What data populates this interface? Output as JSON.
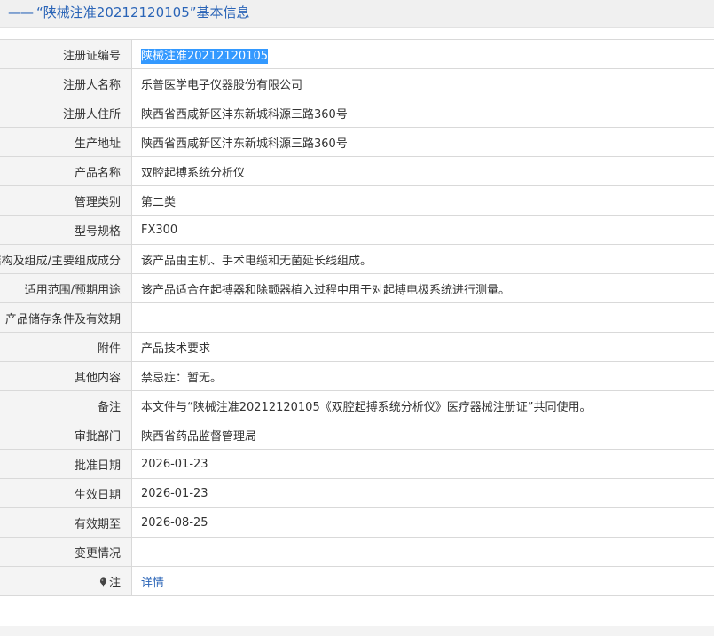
{
  "header": {
    "dash": "——",
    "title": "“陕械注准20212120105”基本信息"
  },
  "rows": [
    {
      "label": "注册证编号",
      "value": "陕械注准20212120105",
      "selected": true
    },
    {
      "label": "注册人名称",
      "value": "乐普医学电子仪器股份有限公司"
    },
    {
      "label": "注册人住所",
      "value": "陕西省西咸新区沣东新城科源三路360号"
    },
    {
      "label": "生产地址",
      "value": "陕西省西咸新区沣东新城科源三路360号"
    },
    {
      "label": "产品名称",
      "value": "双腔起搏系统分析仪"
    },
    {
      "label": "管理类别",
      "value": "第二类"
    },
    {
      "label": "型号规格",
      "value": "FX300"
    },
    {
      "label": "结构及组成/主要组成成分",
      "value": "该产品由主机、手术电缆和无菌延长线组成。"
    },
    {
      "label": "适用范围/预期用途",
      "value": "该产品适合在起搏器和除颤器植入过程中用于对起搏电极系统进行测量。"
    },
    {
      "label": "产品储存条件及有效期",
      "value": ""
    },
    {
      "label": "附件",
      "value": "产品技术要求"
    },
    {
      "label": "其他内容",
      "value": "禁忌症：暂无。"
    },
    {
      "label": "备注",
      "value": "本文件与“陕械注准20212120105《双腔起搏系统分析仪》医疗器械注册证”共同使用。"
    },
    {
      "label": "审批部门",
      "value": "陕西省药品监督管理局"
    },
    {
      "label": "批准日期",
      "value": "2026-01-23"
    },
    {
      "label": "生效日期",
      "value": "2026-01-23"
    },
    {
      "label": "有效期至",
      "value": "2026-08-25"
    },
    {
      "label": "变更情况",
      "value": ""
    }
  ],
  "note_row": {
    "label": "注",
    "icon": "pin-icon",
    "link": "详情"
  }
}
